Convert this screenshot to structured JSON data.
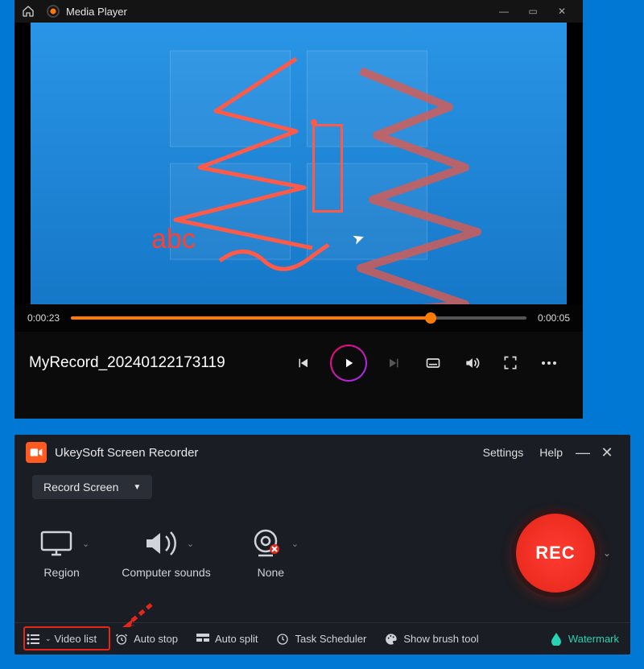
{
  "player": {
    "app_title": "Media Player",
    "elapsed": "0:00:23",
    "remaining": "0:00:05",
    "video_title": "MyRecord_20240122173119",
    "annotation_text": "abc"
  },
  "recorder": {
    "app_title": "UkeySoft Screen Recorder",
    "settings_label": "Settings",
    "help_label": "Help",
    "mode_label": "Record Screen",
    "sources": {
      "region_label": "Region",
      "audio_label": "Computer sounds",
      "camera_label": "None"
    },
    "rec_label": "REC",
    "footer": {
      "video_list": "Video list",
      "auto_stop": "Auto stop",
      "auto_split": "Auto split",
      "task_scheduler": "Task Scheduler",
      "show_brush": "Show brush tool",
      "watermark": "Watermark"
    }
  }
}
